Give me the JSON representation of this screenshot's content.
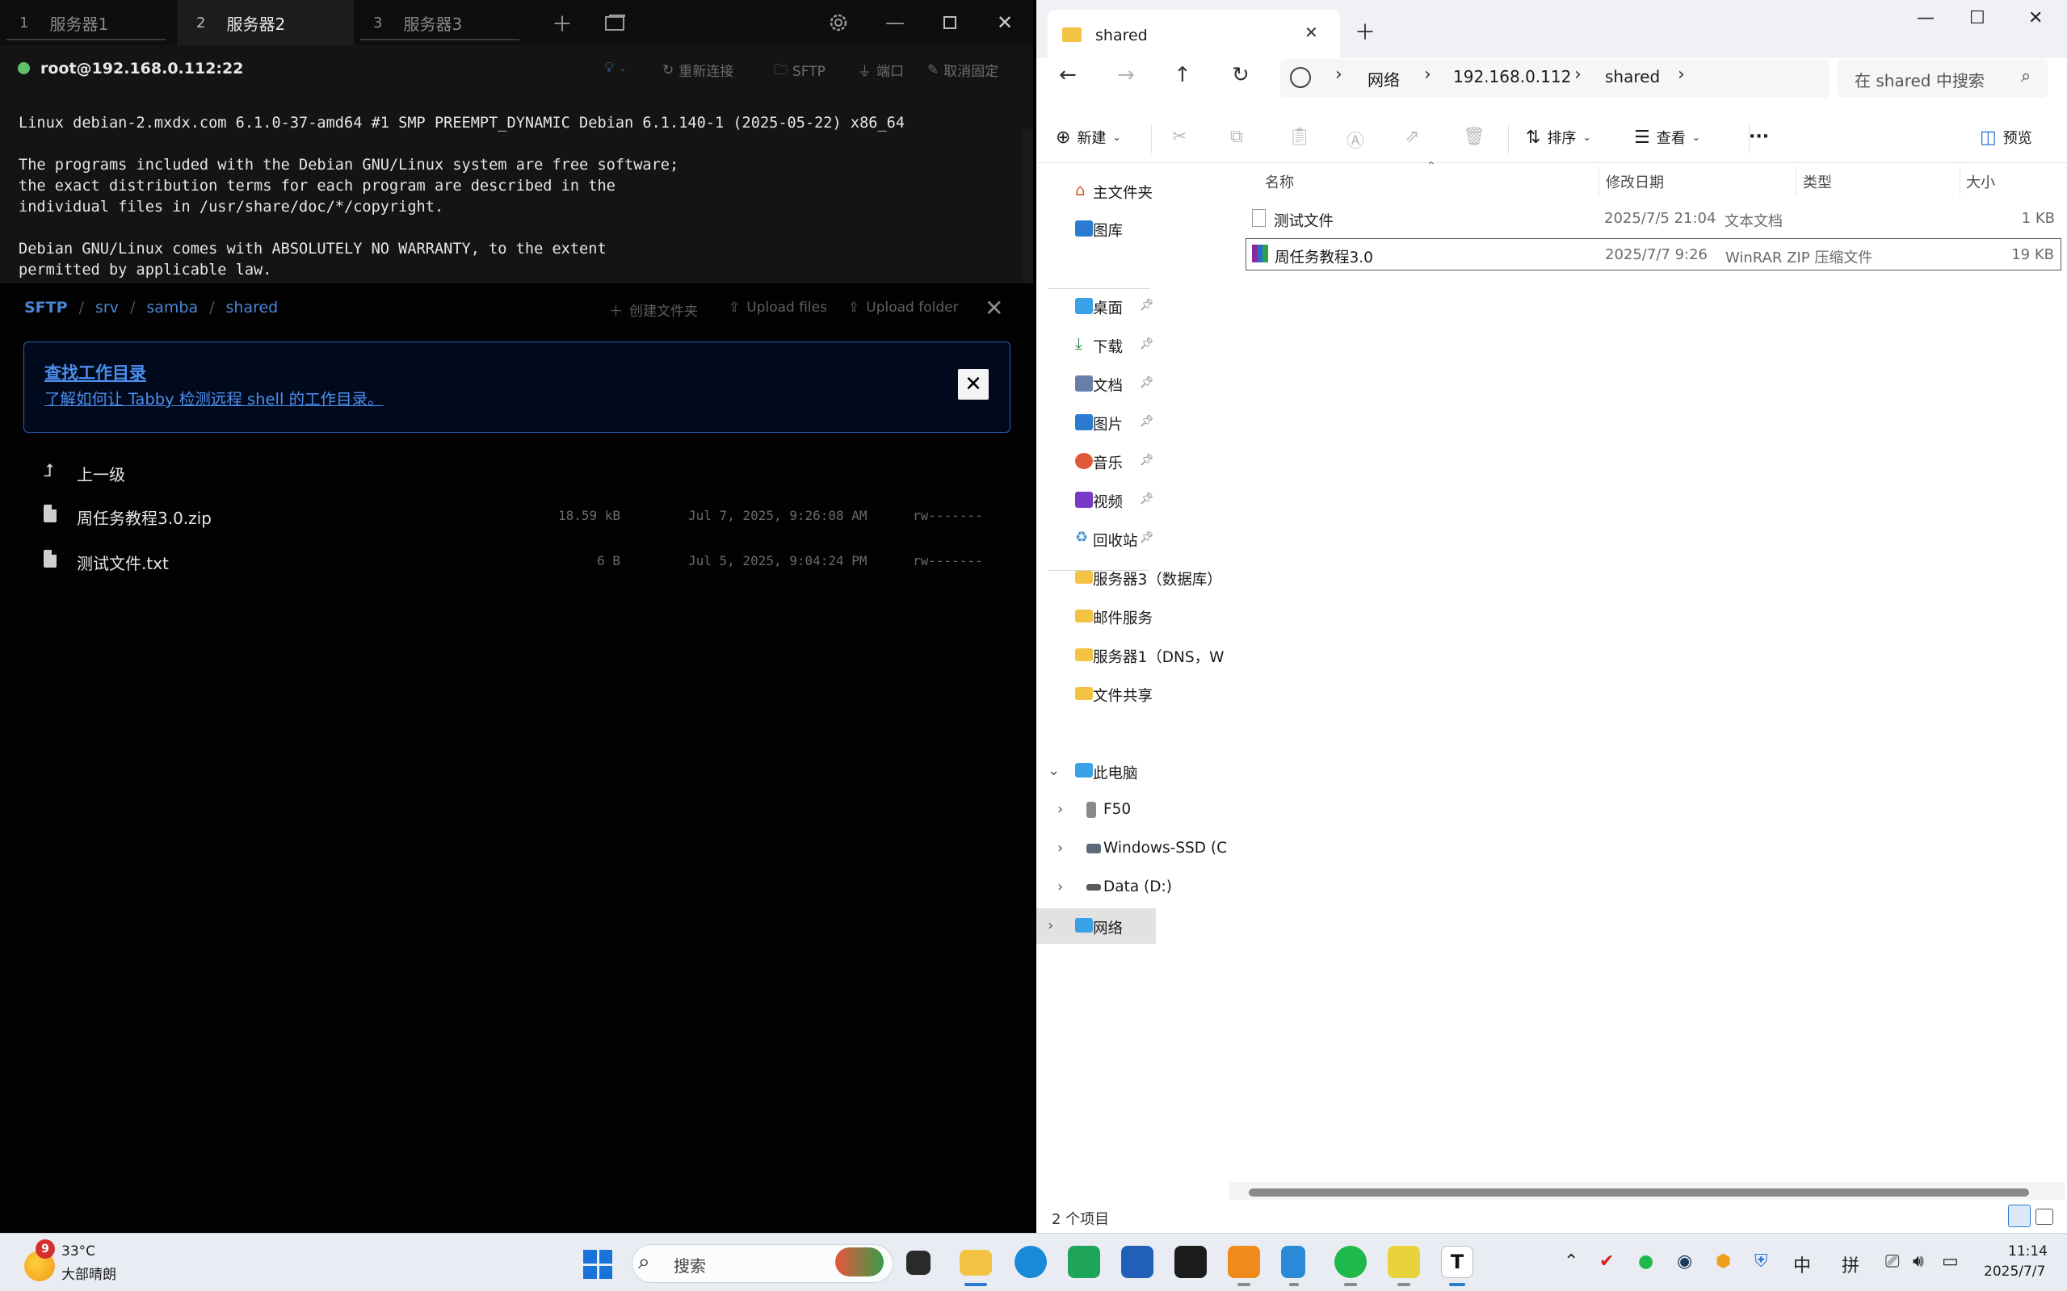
{
  "tabby": {
    "tabs": [
      {
        "num": "1",
        "label": "服务器1"
      },
      {
        "num": "2",
        "label": "服务器2"
      },
      {
        "num": "3",
        "label": "服务器3"
      }
    ],
    "connection": "root@192.168.0.112:22",
    "actions": {
      "reconnect": "重新连接",
      "sftp": "SFTP",
      "ports": "端口",
      "unpin": "取消固定"
    },
    "terminal": [
      "Linux debian-2.mxdx.com 6.1.0-37-amd64 #1 SMP PREEMPT_DYNAMIC Debian 6.1.140-1 (2025-05-22) x86_64",
      "",
      "The programs included with the Debian GNU/Linux system are free software;",
      "the exact distribution terms for each program are described in the",
      "individual files in /usr/share/doc/*/copyright.",
      "",
      "Debian GNU/Linux comes with ABSOLUTELY NO WARRANTY, to the extent",
      "permitted by applicable law."
    ],
    "sftp": {
      "path": [
        "SFTP",
        "srv",
        "samba",
        "shared"
      ],
      "create_folder": "创建文件夹",
      "upload_files": "Upload files",
      "upload_folder": "Upload folder",
      "notice_title": "查找工作目录",
      "notice_link": "了解如何让 Tabby 检测远程 shell 的工作目录。",
      "notice_close": "✕",
      "parent": "上一级",
      "files": [
        {
          "name": "周任务教程3.0.zip",
          "size": "18.59 kB",
          "date": "Jul 7, 2025, 9:26:08 AM",
          "perms": "rw-------"
        },
        {
          "name": "测试文件.txt",
          "size": "6 B",
          "date": "Jul 5, 2025, 9:04:24 PM",
          "perms": "rw-------"
        }
      ]
    }
  },
  "explorer": {
    "tab_title": "shared",
    "breadcrumbs": [
      "网络",
      "192.168.0.112",
      "shared"
    ],
    "search_placeholder": "在 shared 中搜索",
    "cmd": {
      "new": "新建",
      "sort": "排序",
      "view": "查看",
      "more": "···",
      "preview": "预览"
    },
    "sidebar": {
      "home": "主文件夹",
      "gallery": "图库",
      "pinned": [
        {
          "label": "桌面",
          "color": "#3aa0e8"
        },
        {
          "label": "下载",
          "color": "#2a8a4a"
        },
        {
          "label": "文档",
          "color": "#6a7fa8"
        },
        {
          "label": "图片",
          "color": "#2b7bd0"
        },
        {
          "label": "音乐",
          "color": "#e05a3a"
        },
        {
          "label": "视频",
          "color": "#7a3ac8"
        },
        {
          "label": "回收站",
          "color": "#4a90d0"
        }
      ],
      "folders": [
        "服务器3（数据库）",
        "邮件服务",
        "服务器1（DNS，W",
        "文件共享"
      ],
      "this_pc": "此电脑",
      "drives": [
        "F50",
        "Windows-SSD (C",
        "Data (D:)"
      ],
      "network": "网络"
    },
    "columns": {
      "name": "名称",
      "date": "修改日期",
      "type": "类型",
      "size": "大小"
    },
    "files": [
      {
        "name": "测试文件",
        "date": "2025/7/5 21:04",
        "type": "文本文档",
        "size": "1 KB"
      },
      {
        "name": "周任务教程3.0",
        "date": "2025/7/7 9:26",
        "type": "WinRAR ZIP 压缩文件",
        "size": "19 KB"
      }
    ],
    "status": "2 个项目"
  },
  "taskbar": {
    "weather_badge": "9",
    "weather_temp": "33°C",
    "weather_desc": "大部晴朗",
    "search": "搜索",
    "tray_ime1": "中",
    "tray_ime2": "拼",
    "time": "11:14",
    "date": "2025/7/7"
  },
  "colors": {
    "accent": "#4a86d6",
    "online": "#5ec26a",
    "folder": "#f4c343"
  }
}
